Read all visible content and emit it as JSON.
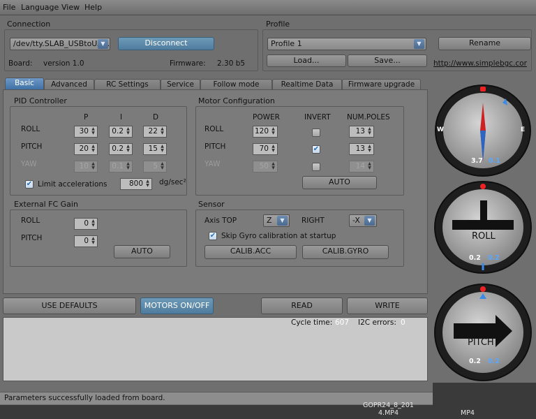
{
  "menu": {
    "file": "File",
    "language": "Language",
    "view": "View",
    "help": "Help"
  },
  "connection": {
    "title": "Connection",
    "port": "/dev/tty.SLAB_USBtoUA...",
    "disconnect": "Disconnect",
    "board_label": "Board:",
    "board_version": "version 1.0",
    "firmware_label": "Firmware:",
    "firmware_version": "2.30 b5"
  },
  "profile": {
    "title": "Profile",
    "selected": "Profile 1",
    "rename": "Rename",
    "load": "Load...",
    "save": "Save...",
    "link": "http://www.simplebgc.cor"
  },
  "tabs": [
    "Basic",
    "Advanced",
    "RC Settings",
    "Service",
    "Follow mode",
    "Realtime Data",
    "Firmware upgrade"
  ],
  "pid": {
    "title": "PID Controller",
    "headers": [
      "P",
      "I",
      "D"
    ],
    "rows": [
      {
        "label": "ROLL",
        "p": "30",
        "i": "0.2",
        "d": "22"
      },
      {
        "label": "PITCH",
        "p": "20",
        "i": "0.2",
        "d": "15"
      },
      {
        "label": "YAW",
        "p": "10",
        "i": "0.1",
        "d": "5"
      }
    ],
    "limit_label": "Limit accelerations",
    "limit_value": "800",
    "limit_unit": "dg/sec²"
  },
  "motor": {
    "title": "Motor Configuration",
    "headers": [
      "POWER",
      "INVERT",
      "NUM.POLES"
    ],
    "rows": [
      {
        "label": "ROLL",
        "power": "120",
        "invert": false,
        "poles": "13"
      },
      {
        "label": "PITCH",
        "power": "70",
        "invert": true,
        "poles": "13"
      },
      {
        "label": "YAW",
        "power": "50",
        "invert": false,
        "poles": "14"
      }
    ],
    "auto": "AUTO"
  },
  "extfc": {
    "title": "External FC Gain",
    "roll_label": "ROLL",
    "roll": "0",
    "pitch_label": "PITCH",
    "pitch": "0",
    "auto": "AUTO"
  },
  "sensor": {
    "title": "Sensor",
    "axis_top_label": "Axis TOP",
    "axis_top": "Z",
    "right_label": "RIGHT",
    "right": "-X",
    "skip_gyro": "Skip Gyro calibration at startup",
    "calib_acc": "CALIB.ACC",
    "calib_gyro": "CALIB.GYRO"
  },
  "actions": {
    "defaults": "USE DEFAULTS",
    "motors": "MOTORS ON/OFF",
    "read": "READ",
    "write": "WRITE"
  },
  "log": {
    "cycle_label": "Cycle time:",
    "cycle_value": "607",
    "i2c_label": "I2C errors:",
    "i2c_value": "0"
  },
  "status": "Parameters successfully loaded from board.",
  "gauges": {
    "compass": {
      "west": "W",
      "east": "E",
      "val1": "3.7",
      "val2": "0.1"
    },
    "roll": {
      "label": "ROLL",
      "val1": "0.2",
      "val2": "0.2"
    },
    "pitch": {
      "label": "PITCH",
      "val1": "0.2",
      "val2": "0.2"
    }
  },
  "desktop": {
    "file1": "GOPR24_8_201",
    "file1b": "4.MP4",
    "file2": "MP4"
  },
  "colors": {
    "accent": "#5a87bd",
    "panel": "#7b7b7b"
  }
}
